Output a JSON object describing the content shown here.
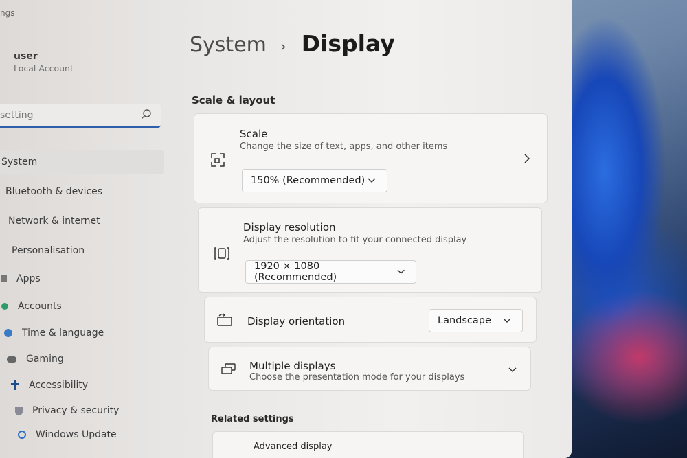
{
  "window": {
    "title_fragment": "ngs"
  },
  "sidebar": {
    "user": {
      "name": "user",
      "account_type": "Local Account"
    },
    "search": {
      "placeholder": "setting"
    },
    "items": [
      {
        "label": "System",
        "icon": "system-icon",
        "active": true
      },
      {
        "label": "Bluetooth & devices",
        "icon": "bluetooth-icon"
      },
      {
        "label": "Network & internet",
        "icon": "network-icon"
      },
      {
        "label": "Personalisation",
        "icon": "brush-icon"
      },
      {
        "label": "Apps",
        "icon": "apps-icon"
      },
      {
        "label": "Accounts",
        "icon": "accounts-icon"
      },
      {
        "label": "Time & language",
        "icon": "globe-icon"
      },
      {
        "label": "Gaming",
        "icon": "gamepad-icon"
      },
      {
        "label": "Accessibility",
        "icon": "accessibility-icon"
      },
      {
        "label": "Privacy & security",
        "icon": "shield-icon"
      },
      {
        "label": "Windows Update",
        "icon": "update-icon"
      }
    ]
  },
  "header": {
    "parent": "System",
    "separator": "›",
    "current": "Display"
  },
  "sections": {
    "scale_layout": "Scale & layout",
    "related": "Related settings"
  },
  "cards": {
    "scale": {
      "title": "Scale",
      "subtitle": "Change the size of text, apps, and other items",
      "value": "150% (Recommended)"
    },
    "resolution": {
      "title": "Display resolution",
      "subtitle": "Adjust the resolution to fit your connected display",
      "value": "1920 × 1080 (Recommended)"
    },
    "orientation": {
      "title": "Display orientation",
      "value": "Landscape"
    },
    "multiple": {
      "title": "Multiple displays",
      "subtitle": "Choose the presentation mode for your displays"
    },
    "advanced": {
      "title": "Advanced display"
    }
  },
  "colors": {
    "accent": "#2e5fa8",
    "active_item_bg": "#e0dedc"
  }
}
